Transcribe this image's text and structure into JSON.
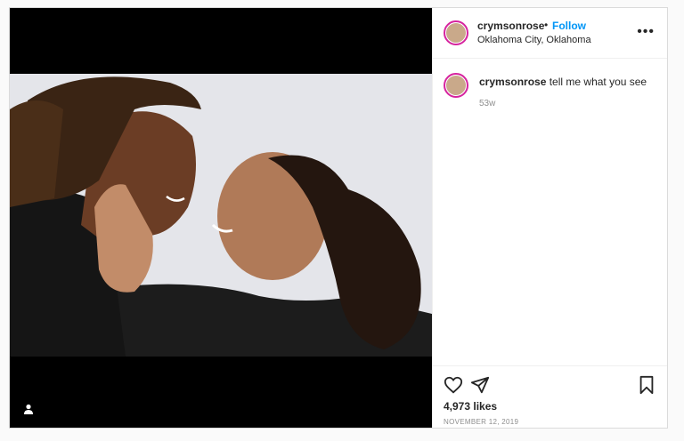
{
  "post": {
    "username": "crymsonrose",
    "separator": "•",
    "follow_label": "Follow",
    "location": "Oklahoma City, Oklahoma",
    "more_icon": "more-options-icon",
    "caption_user": "crymsonrose",
    "caption_text": "tell me what you see",
    "caption_age": "53w",
    "likes": "4,973 likes",
    "date": "NOVEMBER 12, 2019"
  },
  "icons": {
    "like": "heart-icon",
    "share": "paper-plane-icon",
    "save": "bookmark-icon",
    "tag": "user-tag-icon"
  },
  "colors": {
    "accent": "#0095f6",
    "story_ring": "#d6249f",
    "muted": "#8e8e8e"
  }
}
